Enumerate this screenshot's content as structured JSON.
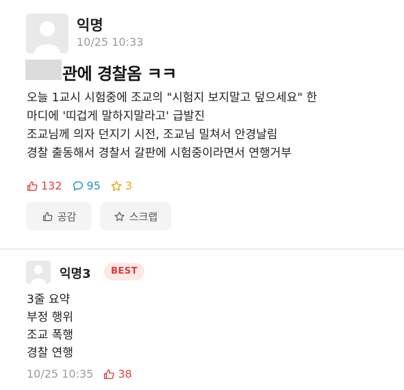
{
  "post": {
    "author": "익명",
    "time": "10/25 10:33",
    "title": "관에 경찰옴 ㅋㅋ",
    "body_lines": [
      "오늘 1교시 시험중에 조교의 \"시험지 보지말고 덮으세요\" 한",
      "마디에 '띠겁게 말하지말라고' 급발진",
      "조교님께 의자 던지기 시전, 조교님 밀쳐서 안경날림",
      "경찰 출동해서 경찰서 갈판에 시험중이라면서 연행거부"
    ],
    "stats": {
      "likes": "132",
      "comments": "95",
      "scraps": "3"
    },
    "buttons": {
      "like": "공감",
      "scrap": "스크랩"
    }
  },
  "comment": {
    "author": "익명3",
    "badge": "BEST",
    "body_lines": [
      "3줄 요약",
      "부정 행위",
      "조교 폭행",
      "경찰 연행"
    ],
    "time": "10/25 10:35",
    "likes": "38"
  },
  "icons": {
    "like": "thumbs-up-icon",
    "comment": "speech-bubble-icon",
    "scrap": "star-icon",
    "avatar": "default-avatar-icon"
  },
  "colors": {
    "like": "#e0443b",
    "comment": "#2a8fcb",
    "scrap": "#e3a80c",
    "badge_bg": "#fbe9e8"
  }
}
